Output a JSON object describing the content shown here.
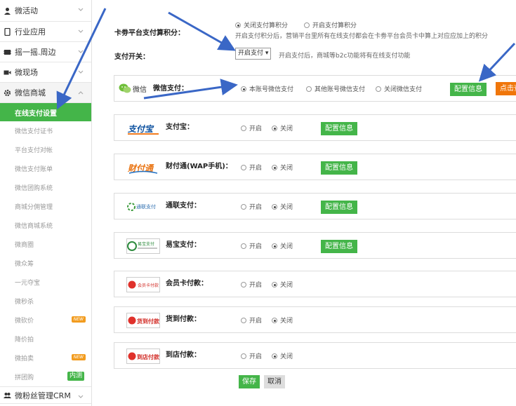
{
  "sidebar": {
    "sections_top": [
      {
        "label": "微活动",
        "icon": "person-icon"
      },
      {
        "label": "行业应用",
        "icon": "phone-icon"
      },
      {
        "label": "摇一摇.周边",
        "icon": "shake-icon"
      },
      {
        "label": "微现场",
        "icon": "camera-icon"
      }
    ],
    "open_section": {
      "label": "微信商城",
      "icon": "gear-icon"
    },
    "items": [
      "在线支付设置",
      "微信支付证书",
      "平台支付对帐",
      "微信支付账单",
      "微信团购系统",
      "商城分佣管理",
      "微信商城系统",
      "微商圈",
      "微众筹",
      "一元夺宝",
      "微秒杀",
      "微砍价",
      "降价拍",
      "微拍卖",
      "拼团购"
    ],
    "badges": {
      "new": "NEW",
      "inner": "内测"
    },
    "bottom_section": {
      "label": "微粉丝管理CRM",
      "icon": "fans-icon"
    }
  },
  "points": {
    "label": "卡劵平台支付算积分：",
    "opt_off": "关闭支付算积分",
    "opt_on": "开启支付算积分",
    "hint": "开启支付积分后，营销平台里所有在线支付都会在卡劵平台会员卡中算上对应应加上的积分"
  },
  "switch": {
    "label": "支付开关：",
    "select_value": "开启支付",
    "hint": "开启支付后，商城等b2c功能将有在线支付功能"
  },
  "wechat": {
    "logo_text": "微信",
    "name": "微信支付：",
    "opt1": "本账号微信支付",
    "opt2": "其他账号微信支付",
    "opt3": "关闭微信支付",
    "config_button": "配置信息",
    "orange_button": "点击查看"
  },
  "methods": [
    {
      "name": "支付宝：",
      "logo": "支付宝",
      "config": "配置信息"
    },
    {
      "name": "财付通(WAP手机)：",
      "logo": "财付通",
      "config": "配置信息"
    },
    {
      "name": "通联支付：",
      "logo": "通联支付",
      "config": "配置信息"
    },
    {
      "name": "易宝支付：",
      "logo": "易宝支付",
      "config": "配置信息"
    },
    {
      "name": "会员卡付款：",
      "logo": "会员卡付款",
      "config": ""
    },
    {
      "name": "货到付款：",
      "logo": "货到付款",
      "config": ""
    },
    {
      "name": "到店付款：",
      "logo": "到店付款",
      "config": ""
    }
  ],
  "common": {
    "open": "开启",
    "close": "关闭"
  },
  "buttons": {
    "save": "保存",
    "cancel": "取消"
  },
  "colors": {
    "accent": "#44b549",
    "orange": "#f0760a",
    "arrow": "#3a67c6"
  }
}
